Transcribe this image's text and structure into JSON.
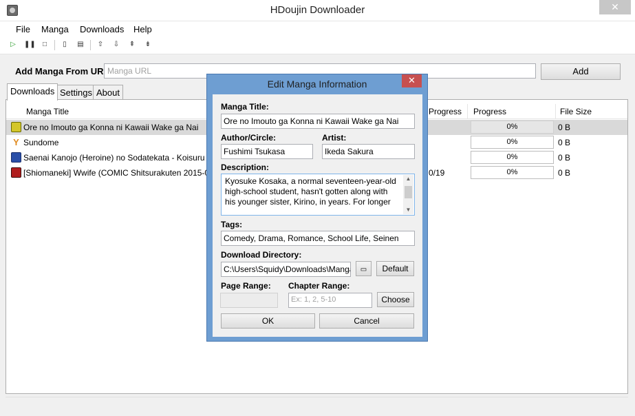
{
  "window": {
    "title": "HDoujin Downloader",
    "close": "✕"
  },
  "menu": [
    "File",
    "Manga",
    "Downloads",
    "Help"
  ],
  "toolbar": {
    "icons": [
      "play-icon",
      "pause-icon",
      "stop-icon",
      "clipboard-icon",
      "paste-icon",
      "move-up-icon",
      "move-down-icon",
      "move-top-icon",
      "move-bottom-icon"
    ]
  },
  "url_bar": {
    "label": "Add Manga From URL:",
    "placeholder": "Manga URL",
    "add_button": "Add"
  },
  "tabs": [
    "Downloads",
    "Settings",
    "About"
  ],
  "columns": {
    "title": "Manga Title",
    "progress_text": "Progress",
    "progress": "Progress",
    "file_size": "File Size"
  },
  "rows": [
    {
      "title": "Ore no Imouto ga Konna ni Kawaii Wake ga Nai",
      "extra": "",
      "progress": "0%",
      "size": "0 B"
    },
    {
      "title": "Sundome",
      "extra": "",
      "progress": "0%",
      "size": "0 B"
    },
    {
      "title": "Saenai Kanojo (Heroine) no Sodatekata - Koisuru Metronome",
      "extra": "",
      "progress": "0%",
      "size": "0 B"
    },
    {
      "title": "[Shiomaneki] Wwife (COMIC Shitsurakuten 2015-0",
      "extra": "0/19",
      "progress": "0%",
      "size": "0 B"
    }
  ],
  "dialog": {
    "title": "Edit Manga Information",
    "close": "✕",
    "manga_title_label": "Manga Title:",
    "manga_title": "Ore no Imouto ga Konna ni Kawaii Wake ga Nai",
    "author_label": "Author/Circle:",
    "author": "Fushimi Tsukasa",
    "artist_label": "Artist:",
    "artist": "Ikeda Sakura",
    "description_label": "Description:",
    "description": "Kyosuke Kosaka, a normal seventeen-year-old high-school student, hasn't gotten along with his younger sister, Kirino, in years. For longer",
    "tags_label": "Tags:",
    "tags": "Comedy, Drama, Romance, School Life, Seinen",
    "directory_label": "Download Directory:",
    "directory": "C:\\Users\\Squidy\\Downloads\\Manga",
    "default_button": "Default",
    "page_range_label": "Page Range:",
    "chapter_range_label": "Chapter Range:",
    "chapter_range_placeholder": "Ex: 1, 2, 5-10",
    "choose_button": "Choose",
    "ok_button": "OK",
    "cancel_button": "Cancel"
  }
}
